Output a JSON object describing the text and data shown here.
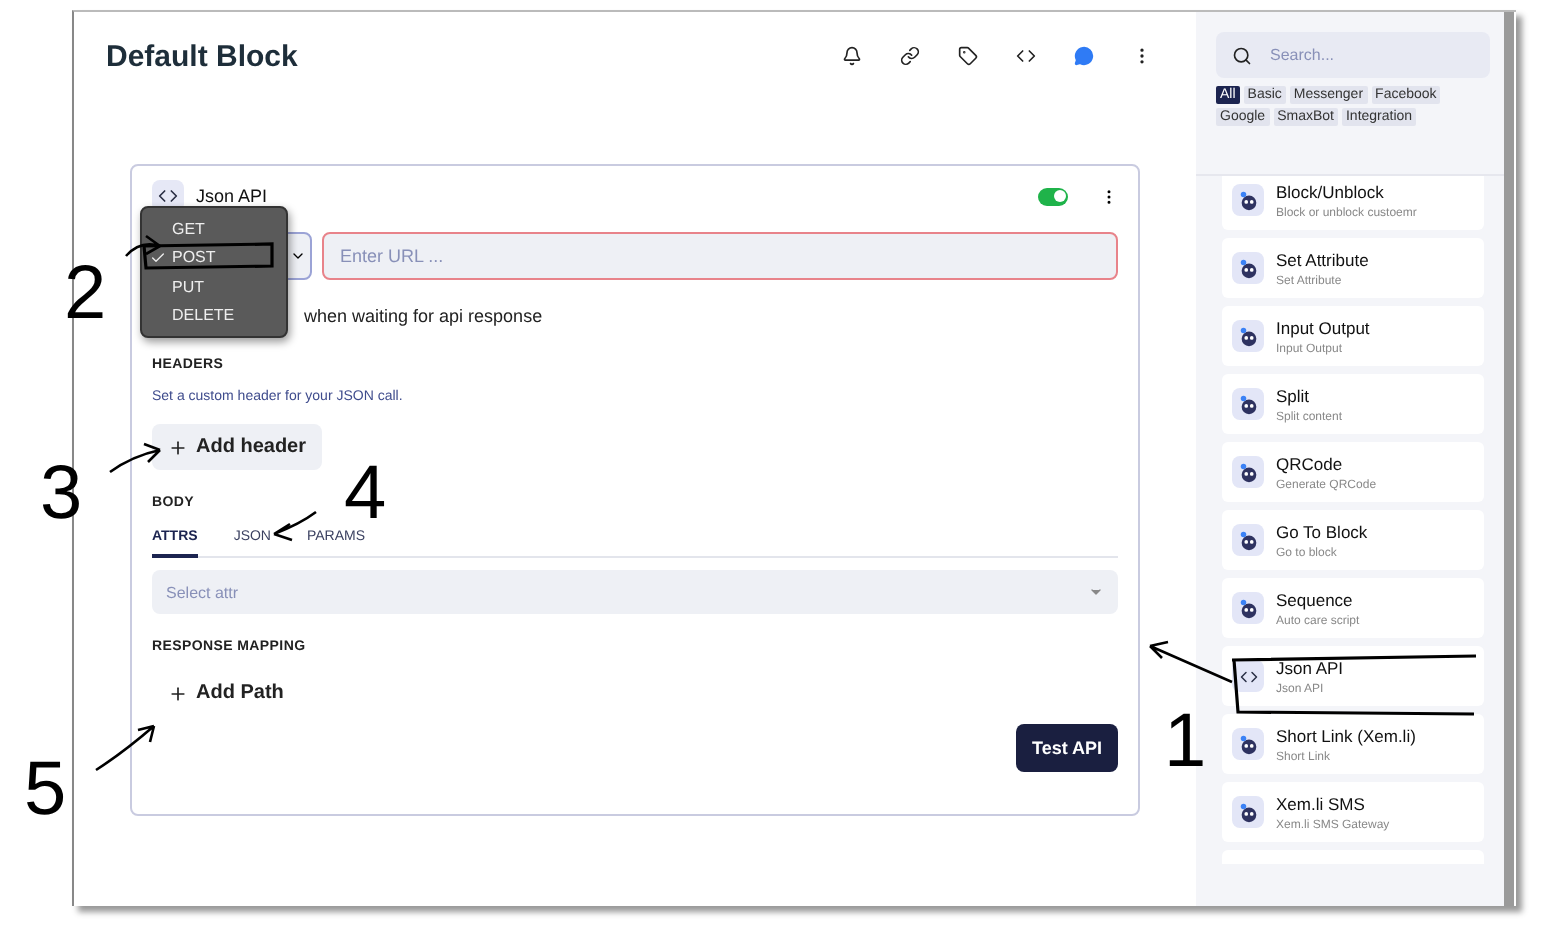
{
  "window": {
    "title": "Default Block"
  },
  "block": {
    "title": "Json API",
    "enabled": true,
    "method_menu": {
      "options": [
        {
          "label": "GET",
          "selected": false
        },
        {
          "label": "POST",
          "selected": true
        },
        {
          "label": "PUT",
          "selected": false
        },
        {
          "label": "DELETE",
          "selected": false
        }
      ]
    },
    "url": {
      "placeholder": "Enter URL ..."
    },
    "wait_note": "when waiting for api response",
    "headers": {
      "heading": "HEADERS",
      "description": "Set a custom header for your JSON call.",
      "button": "Add header"
    },
    "body": {
      "heading": "BODY",
      "tabs": [
        {
          "label": "ATTRS",
          "selected": true
        },
        {
          "label": "JSON",
          "selected": false
        },
        {
          "label": "PARAMS",
          "selected": false
        }
      ],
      "select": {
        "placeholder": "Select attr"
      }
    },
    "response_mapping": {
      "heading": "RESPONSE MAPPING",
      "button": "Add Path"
    },
    "test_button": "Test API"
  },
  "sidebar": {
    "search": {
      "placeholder": "Search..."
    },
    "filters": [
      {
        "label": "All",
        "selected": true
      },
      {
        "label": "Basic",
        "selected": false
      },
      {
        "label": "Messenger",
        "selected": false
      },
      {
        "label": "Facebook",
        "selected": false
      },
      {
        "label": "Google",
        "selected": false
      },
      {
        "label": "SmaxBot",
        "selected": false
      },
      {
        "label": "Integration",
        "selected": false
      }
    ],
    "items": [
      {
        "kind": "bot",
        "title": "Block/Unblock",
        "subtitle": "Block or unblock custoemr"
      },
      {
        "kind": "bot",
        "title": "Set Attribute",
        "subtitle": "Set Attribute"
      },
      {
        "kind": "bot",
        "title": "Input Output",
        "subtitle": "Input Output"
      },
      {
        "kind": "bot",
        "title": "Split",
        "subtitle": "Split content"
      },
      {
        "kind": "bot",
        "title": "QRCode",
        "subtitle": "Generate QRCode"
      },
      {
        "kind": "bot",
        "title": "Go To Block",
        "subtitle": "Go to block"
      },
      {
        "kind": "bot",
        "title": "Sequence",
        "subtitle": "Auto care script"
      },
      {
        "kind": "code",
        "title": "Json API",
        "subtitle": "Json API"
      },
      {
        "kind": "bot",
        "title": "Short Link (Xem.li)",
        "subtitle": "Short Link"
      },
      {
        "kind": "bot",
        "title": "Xem.li SMS",
        "subtitle": "Xem.li SMS Gateway"
      }
    ]
  },
  "annotations": [
    {
      "label": "1"
    },
    {
      "label": "2"
    },
    {
      "label": "3"
    },
    {
      "label": "4"
    },
    {
      "label": "5"
    }
  ]
}
